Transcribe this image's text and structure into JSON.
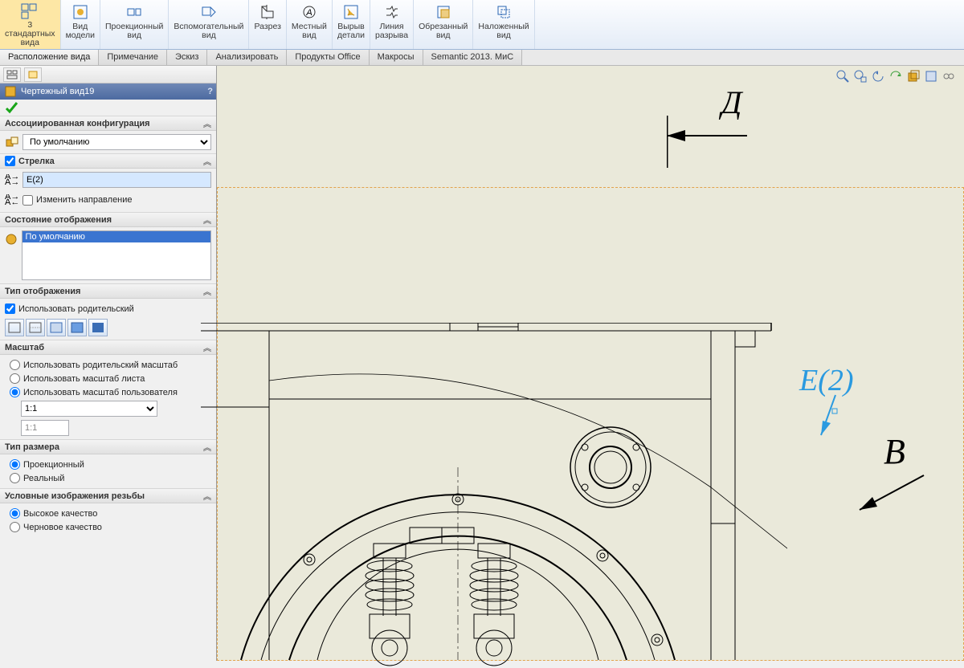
{
  "ribbon": {
    "btn1": "3\nстандартных\nвида",
    "btn2": "Вид\nмодели",
    "btn3": "Проекционный\nвид",
    "btn4": "Вспомогательный\nвид",
    "btn5": "Разрез",
    "btn6": "Местный\nвид",
    "btn7": "Вырыв\nдетали",
    "btn8": "Линия\nразрыва",
    "btn9": "Обрезанный\nвид",
    "btn10": "Наложенный\nвид"
  },
  "tabs": {
    "t1": "Расположение вида",
    "t2": "Примечание",
    "t3": "Эскиз",
    "t4": "Анализировать",
    "t5": "Продукты Office",
    "t6": "Макросы",
    "t7": "Semantic 2013. МиС"
  },
  "feature": {
    "title": "Чертежный вид19"
  },
  "sect_config": {
    "header": "Ассоциированная конфигурация",
    "value": "По умолчанию"
  },
  "sect_arrow": {
    "header": "Стрелка",
    "checkbox1": "",
    "input_value": "Е(2)",
    "checkbox2_label": "Изменить направление"
  },
  "sect_dispstate": {
    "header": "Состояние отображения",
    "item": "По умолчанию"
  },
  "sect_disptype": {
    "header": "Тип отображения",
    "chk": "Использовать родительский"
  },
  "sect_scale": {
    "header": "Масштаб",
    "r1": "Использовать родительский масштаб",
    "r2": "Использовать масштаб листа",
    "r3": "Использовать масштаб пользователя",
    "sel": "1:1",
    "txt": "1:1"
  },
  "sect_dimtype": {
    "header": "Тип размера",
    "r1": "Проекционный",
    "r2": "Реальный"
  },
  "sect_thread": {
    "header": "Условные изображения резьбы",
    "r1": "Высокое качество",
    "r2": "Черновое качество"
  },
  "canvas_labels": {
    "D": "Д",
    "E2": "Е(2)",
    "B": "В"
  }
}
